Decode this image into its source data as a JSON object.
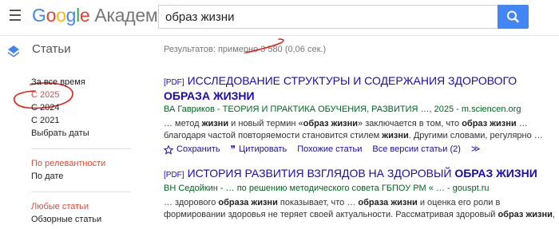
{
  "header": {
    "logo_letters": [
      "G",
      "o",
      "o",
      "g",
      "l",
      "e"
    ],
    "logo_suffix": "Академия",
    "search_value": "образ жизни"
  },
  "section": {
    "title": "Статьи"
  },
  "results_count": "Результатов: примерно 3 580 (0,06 сек.)",
  "sidebar": {
    "time": [
      "За все время",
      "С 2025",
      "С 2024",
      "С 2021",
      "Выбрать даты"
    ],
    "selected_time_index": 1,
    "sort": [
      "По релевантности",
      "По дате"
    ],
    "selected_sort_index": 0,
    "type": [
      "Любые статьи",
      "Обзорные статьи"
    ],
    "selected_type_index": 0
  },
  "results": [
    {
      "pdf": "[PDF]",
      "title_parts": [
        {
          "t": "ИССЛЕДОВАНИЕ СТРУКТУРЫ И СОДЕРЖАНИЯ ЗДОРОВОГО ",
          "b": false
        },
        {
          "t": "ОБРАЗА ЖИЗНИ",
          "b": true
        }
      ],
      "meta": "ВА Гавриков - ТЕОРИЯ И ПРАКТИКА ОБУЧЕНИЯ, РАЗВИТИЯ …, 2025 - m.sciencen.org",
      "snippet_parts": [
        {
          "t": "… метод ",
          "b": false
        },
        {
          "t": "жизни",
          "b": true
        },
        {
          "t": " и новый термин «",
          "b": false
        },
        {
          "t": "образ жизни",
          "b": true
        },
        {
          "t": "» заключается в том, что ",
          "b": false
        },
        {
          "t": "образ жизни",
          "b": true
        },
        {
          "t": " … благодаря частой повторяемости становится стилем ",
          "b": false
        },
        {
          "t": "жизни",
          "b": true
        },
        {
          "t": ". Другими словами, регулярно …",
          "b": false
        }
      ],
      "actions": [
        "Сохранить",
        "Цитировать",
        "Похожие статьи",
        "Все версии статьи (2)"
      ]
    },
    {
      "pdf": "[PDF]",
      "title_parts": [
        {
          "t": "ИСТОРИЯ РАЗВИТИЯ ВЗГЛЯДОВ НА ЗДОРОВЫЙ ",
          "b": false
        },
        {
          "t": "ОБРАЗ ЖИЗНИ",
          "b": true
        }
      ],
      "meta": "ВН Седойкин - … по решению методического совета ГБПОУ РМ « … - gouspt.ru",
      "snippet_parts": [
        {
          "t": "… здорового ",
          "b": false
        },
        {
          "t": "образа жизни",
          "b": true
        },
        {
          "t": " показывает, что … ",
          "b": false
        },
        {
          "t": "образа жизни",
          "b": true
        },
        {
          "t": " и оценка его роли в формировании здоровья не теряет своей актуальности. Рассматривая здоровый ",
          "b": false
        },
        {
          "t": "образ жизни",
          "b": true
        },
        {
          "t": ",",
          "b": false
        }
      ],
      "actions": []
    }
  ],
  "icons": {
    "menu": "hamburger-icon",
    "search": "search-icon",
    "star": "star-icon",
    "quote": "quote-icon",
    "more": "more-icon"
  },
  "colors": {
    "link": "#1a0dab",
    "meta": "#006621",
    "selected": "#dd4b39",
    "accent": "#4285f4"
  }
}
